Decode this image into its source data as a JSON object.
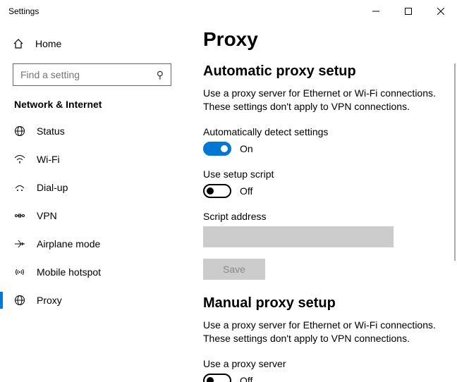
{
  "window": {
    "title": "Settings"
  },
  "sidebar": {
    "home": "Home",
    "search_placeholder": "Find a setting",
    "section": "Network & Internet",
    "items": [
      {
        "label": "Status"
      },
      {
        "label": "Wi-Fi"
      },
      {
        "label": "Dial-up"
      },
      {
        "label": "VPN"
      },
      {
        "label": "Airplane mode"
      },
      {
        "label": "Mobile hotspot"
      },
      {
        "label": "Proxy"
      }
    ]
  },
  "page": {
    "title": "Proxy",
    "auto": {
      "heading": "Automatic proxy setup",
      "desc": "Use a proxy server for Ethernet or Wi-Fi connections. These settings don't apply to VPN connections.",
      "detect_label": "Automatically detect settings",
      "detect_state": "On",
      "script_label": "Use setup script",
      "script_state": "Off",
      "address_label": "Script address",
      "save": "Save"
    },
    "manual": {
      "heading": "Manual proxy setup",
      "desc": "Use a proxy server for Ethernet or Wi-Fi connections. These settings don't apply to VPN connections.",
      "use_label": "Use a proxy server",
      "use_state": "Off"
    }
  }
}
